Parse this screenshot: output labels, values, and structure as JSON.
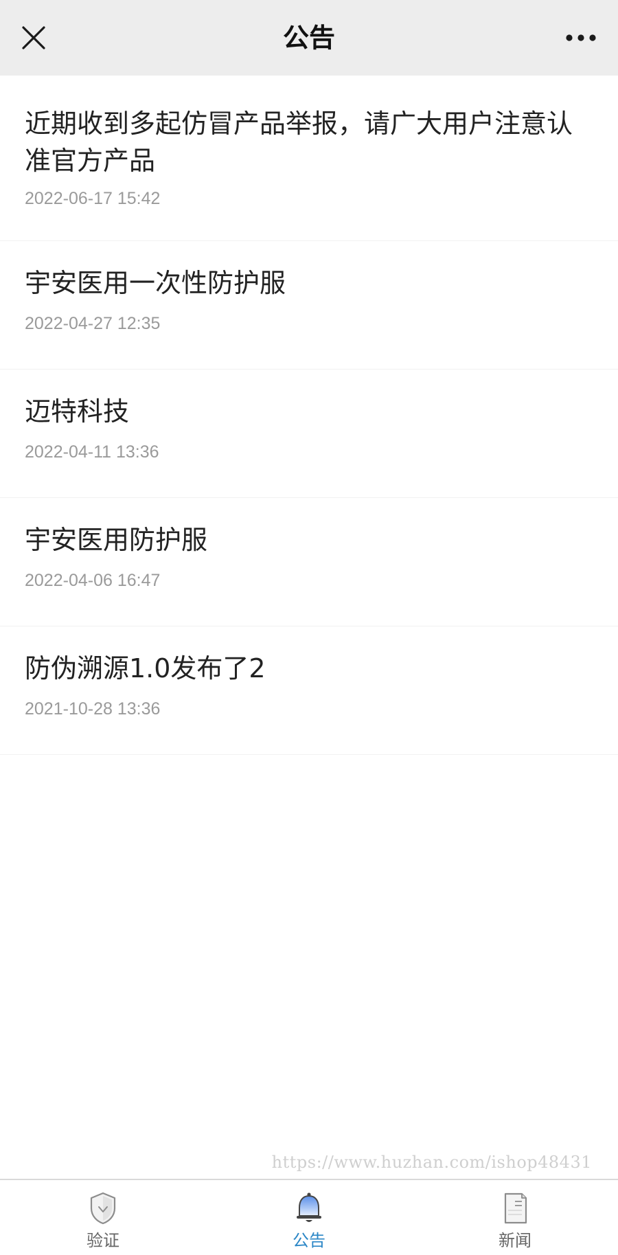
{
  "header": {
    "title": "公告",
    "close_icon": "close-icon",
    "more_icon": "more-dots-icon"
  },
  "announcements": [
    {
      "title": "近期收到多起仿冒产品举报，请广大用户注意认准官方产品",
      "time": "2022-06-17 15:42"
    },
    {
      "title": "宇安医用一次性防护服",
      "time": "2022-04-27 12:35"
    },
    {
      "title": "迈特科技",
      "time": "2022-04-11 13:36"
    },
    {
      "title": "宇安医用防护服",
      "time": "2022-04-06 16:47"
    },
    {
      "title": "防伪溯源1.0发布了2",
      "time": "2021-10-28 13:36"
    }
  ],
  "watermark": "https://www.huzhan.com/ishop48431",
  "tabbar": {
    "tabs": [
      {
        "label": "验证",
        "icon": "shield-icon",
        "active": false
      },
      {
        "label": "公告",
        "icon": "bell-icon",
        "active": true
      },
      {
        "label": "新闻",
        "icon": "document-icon",
        "active": false
      }
    ]
  },
  "colors": {
    "header_bg": "#ededed",
    "active_tab": "#2a86c6",
    "time_text": "#9a9a9a"
  }
}
